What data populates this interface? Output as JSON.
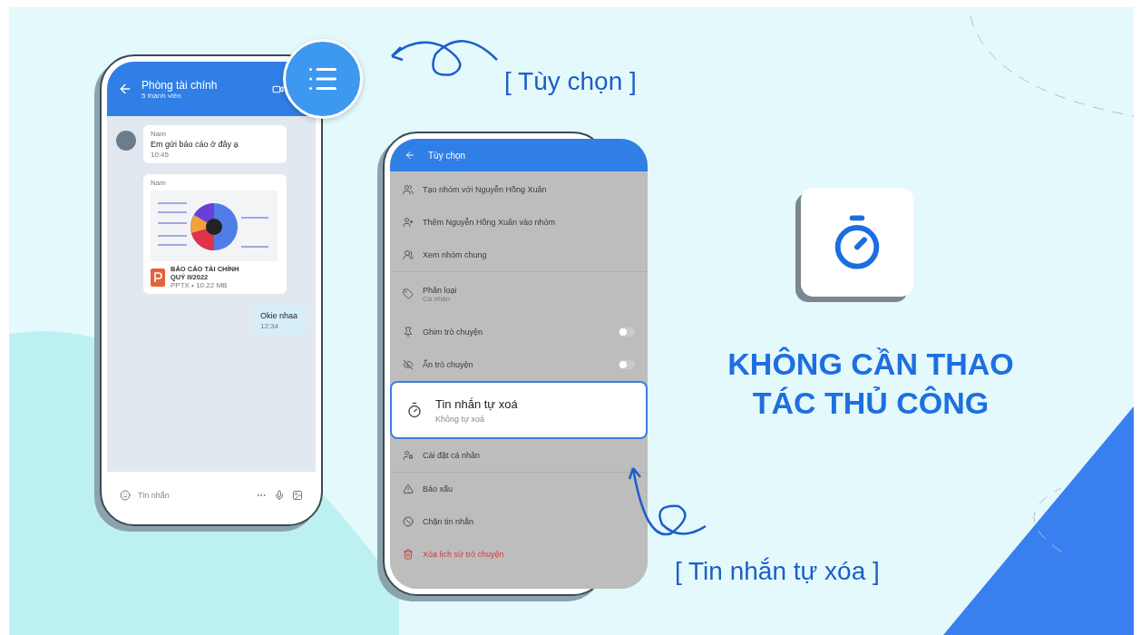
{
  "chat_screen": {
    "header": {
      "title": "Phòng tài chính",
      "subtitle": "5 thành viên"
    },
    "messages": [
      {
        "kind": "text",
        "sender": "Nam",
        "text": "Em gửi báo cáo ở đây ạ",
        "time": "10:45"
      },
      {
        "kind": "file",
        "sender": "Nam",
        "file_name": "BÁO CÁO TÀI CHÍNH QUÝ II/2022",
        "file_meta": "PPTX • 10.22 MB"
      },
      {
        "kind": "outgoing",
        "text": "Okie nhaa",
        "time": "12:34"
      }
    ],
    "input": {
      "placeholder": "Tin nhắn"
    }
  },
  "callouts": [
    {
      "label": "[ Tùy chọn ]"
    },
    {
      "label": "[ Tin nhắn tự xóa ]"
    }
  ],
  "options_screen": {
    "title": "Tùy chọn",
    "sections": [
      {
        "items": [
          {
            "kind": "item",
            "label": "Tạo nhóm với Nguyễn Hồng Xuân"
          },
          {
            "kind": "item",
            "label": "Thêm Nguyễn Hồng Xuân vào nhóm"
          },
          {
            "kind": "item",
            "label": "Xem nhóm chung"
          }
        ]
      },
      {
        "items": [
          {
            "kind": "item",
            "label": "Phân loại",
            "subtitle": "Cá nhân"
          },
          {
            "kind": "toggle",
            "label": "Ghim trò chuyện",
            "on": false
          },
          {
            "kind": "toggle",
            "label": "Ẩn trò chuyện",
            "on": false
          },
          {
            "kind": "highlight",
            "label": "Tin nhắn tự xoá",
            "subtitle": "Không tự xoá"
          },
          {
            "kind": "item",
            "label": "Cài đặt cá nhân"
          }
        ]
      },
      {
        "items": [
          {
            "kind": "item",
            "label": "Báo xấu"
          },
          {
            "kind": "item",
            "label": "Chặn tin nhắn"
          },
          {
            "kind": "danger",
            "label": "Xóa lịch sử trò chuyện"
          }
        ]
      }
    ]
  },
  "headline": "KHÔNG CẦN THAO TÁC THỦ CÔNG"
}
